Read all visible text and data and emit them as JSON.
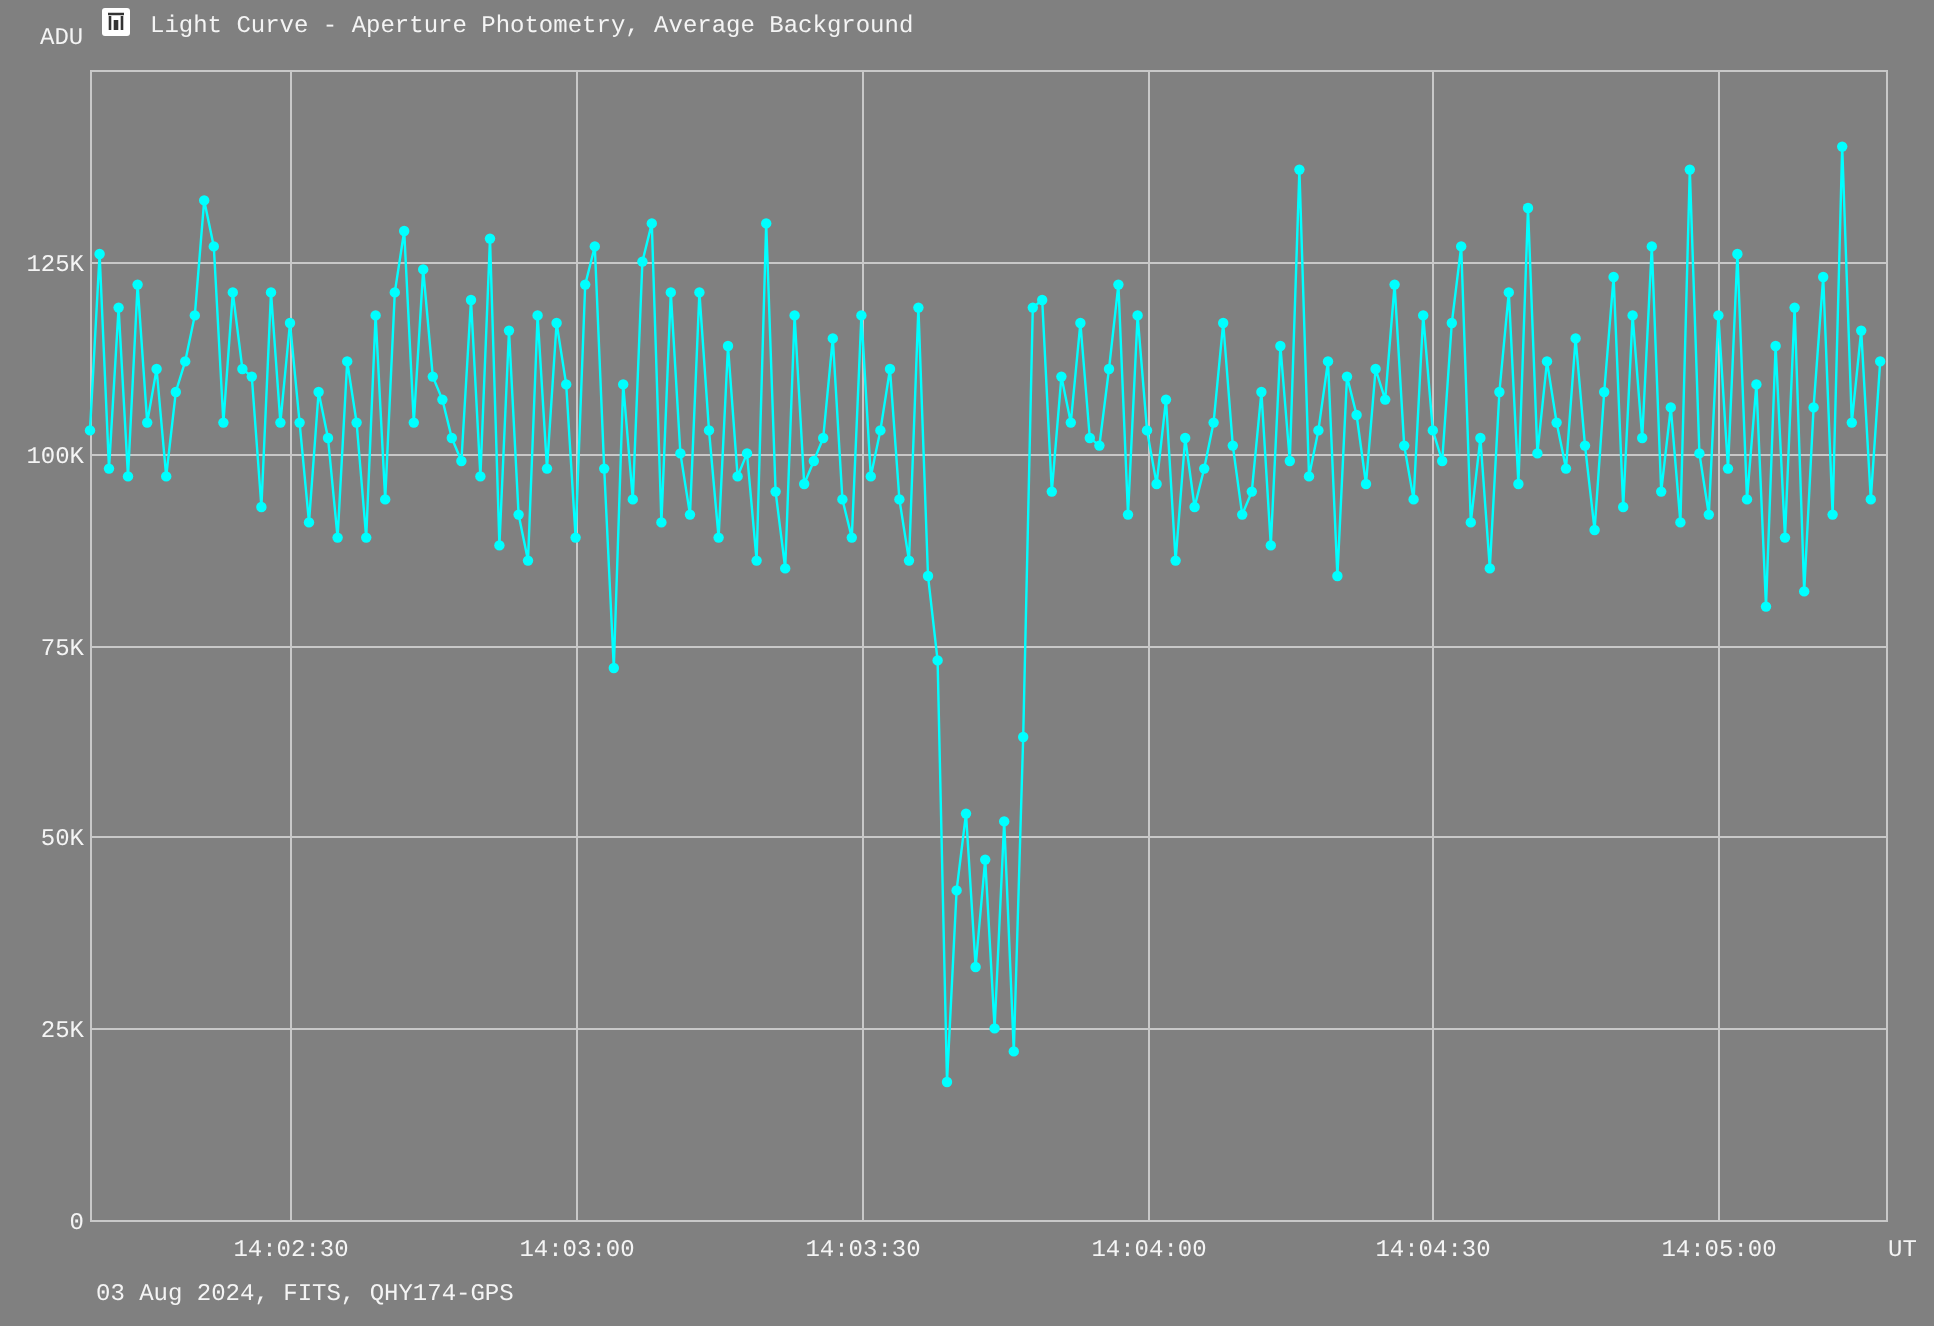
{
  "window": {
    "title": "Light Curve - Aperture Photometry, Average Background"
  },
  "chart": {
    "chart_data": {
      "type": "line",
      "grid": true,
      "xlabel": "UT",
      "ylabel": "ADU",
      "xlim": [
        50529,
        50717.6
      ],
      "ylim": [
        0,
        150
      ],
      "xticks": [
        {
          "value": 50550,
          "label": "14:02:30"
        },
        {
          "value": 50580,
          "label": "14:03:00"
        },
        {
          "value": 50610,
          "label": "14:03:30"
        },
        {
          "value": 50640,
          "label": "14:04:00"
        },
        {
          "value": 50670,
          "label": "14:04:30"
        },
        {
          "value": 50700,
          "label": "14:05:00"
        }
      ],
      "yticks": [
        {
          "value": 0,
          "label": "0"
        },
        {
          "value": 25,
          "label": "25K"
        },
        {
          "value": 50,
          "label": "50K"
        },
        {
          "value": 75,
          "label": "75K"
        },
        {
          "value": 100,
          "label": "100K"
        },
        {
          "value": 125,
          "label": "125K"
        }
      ],
      "x": [
        50529,
        50530,
        50531,
        50532,
        50533,
        50534,
        50535,
        50536,
        50537,
        50538,
        50539,
        50540,
        50541,
        50542,
        50543,
        50544,
        50545,
        50546,
        50547,
        50548,
        50549,
        50550,
        50551,
        50552,
        50553,
        50554,
        50555,
        50556,
        50557,
        50558,
        50559,
        50560,
        50561,
        50562,
        50563,
        50564,
        50565,
        50566,
        50567,
        50568,
        50569,
        50570,
        50571,
        50572,
        50573,
        50574,
        50575,
        50576,
        50577,
        50578,
        50579,
        50580,
        50581,
        50582,
        50583,
        50584,
        50585,
        50586,
        50587,
        50588,
        50589,
        50590,
        50591,
        50592,
        50593,
        50594,
        50595,
        50596,
        50597,
        50598,
        50599,
        50600,
        50601,
        50602,
        50603,
        50604,
        50605,
        50606,
        50607,
        50608,
        50609,
        50610,
        50611,
        50612,
        50613,
        50614,
        50615,
        50616,
        50617,
        50618,
        50619,
        50620,
        50621,
        50622,
        50623,
        50624,
        50625,
        50626,
        50627,
        50628,
        50629,
        50630,
        50631,
        50632,
        50633,
        50634,
        50635,
        50636,
        50637,
        50638,
        50639,
        50640,
        50641,
        50642,
        50643,
        50644,
        50645,
        50646,
        50647,
        50648,
        50649,
        50650,
        50651,
        50652,
        50653,
        50654,
        50655,
        50656,
        50657,
        50658,
        50659,
        50660,
        50661,
        50662,
        50663,
        50664,
        50665,
        50666,
        50667,
        50668,
        50669,
        50670,
        50671,
        50672,
        50673,
        50674,
        50675,
        50676,
        50677,
        50678,
        50679,
        50680,
        50681,
        50682,
        50683,
        50684,
        50685,
        50686,
        50687,
        50688,
        50689,
        50690,
        50691,
        50692,
        50693,
        50694,
        50695,
        50696,
        50697,
        50698,
        50699,
        50700,
        50701,
        50702,
        50703,
        50704,
        50705,
        50706,
        50707,
        50708,
        50709,
        50710,
        50711,
        50712,
        50713,
        50714,
        50715,
        50716,
        50717
      ],
      "series": [
        {
          "color": "#00ffff",
          "marker": "circle",
          "values": [
            103,
            126,
            98,
            119,
            97,
            122,
            104,
            111,
            97,
            108,
            112,
            118,
            133,
            127,
            104,
            121,
            111,
            110,
            93,
            121,
            104,
            117,
            104,
            91,
            108,
            102,
            89,
            112,
            104,
            89,
            118,
            94,
            121,
            129,
            104,
            124,
            110,
            107,
            102,
            99,
            120,
            97,
            128,
            88,
            116,
            92,
            86,
            118,
            98,
            117,
            109,
            89,
            122,
            127,
            98,
            72,
            109,
            94,
            125,
            130,
            91,
            121,
            100,
            92,
            121,
            103,
            89,
            114,
            97,
            100,
            86,
            130,
            95,
            85,
            118,
            96,
            99,
            102,
            115,
            94,
            89,
            118,
            97,
            103,
            111,
            94,
            86,
            119,
            84,
            73,
            18,
            43,
            53,
            33,
            47,
            25,
            52,
            22,
            63,
            119,
            120,
            95,
            110,
            104,
            117,
            102,
            101,
            111,
            122,
            92,
            118,
            103,
            96,
            107,
            86,
            102,
            93,
            98,
            104,
            117,
            101,
            92,
            95,
            108,
            88,
            114,
            99,
            137,
            97,
            103,
            112,
            84,
            110,
            105,
            96,
            111,
            107,
            122,
            101,
            94,
            118,
            103,
            99,
            117,
            127,
            91,
            102,
            85,
            108,
            121,
            96,
            132,
            100,
            112,
            104,
            98,
            115,
            101,
            90,
            108,
            123,
            93,
            118,
            102,
            127,
            95,
            106,
            91,
            137,
            100,
            92,
            118,
            98,
            126,
            94,
            109,
            80,
            114,
            89,
            119,
            82,
            106,
            123,
            92,
            140,
            104,
            116,
            94,
            112
          ]
        }
      ]
    }
  },
  "footer": "03 Aug 2024, FITS, QHY174-GPS"
}
